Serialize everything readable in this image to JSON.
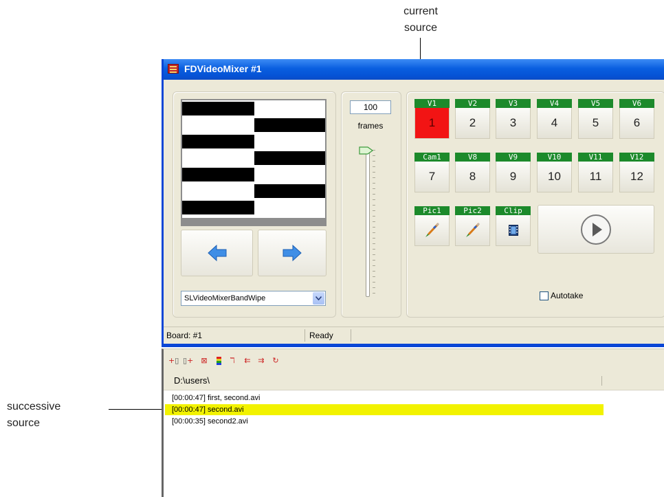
{
  "annotations": {
    "current_source": [
      "current",
      "source"
    ],
    "successive_source": [
      "successive",
      "source"
    ]
  },
  "window": {
    "title": "FDVideoMixer #1"
  },
  "transition": {
    "frames_value": "100",
    "frames_label": "frames",
    "selected": "SLVideoMixerBandWipe"
  },
  "sources": [
    {
      "label": "V1",
      "number": "1",
      "active": true
    },
    {
      "label": "V2",
      "number": "2"
    },
    {
      "label": "V3",
      "number": "3"
    },
    {
      "label": "V4",
      "number": "4"
    },
    {
      "label": "V5",
      "number": "5"
    },
    {
      "label": "V6",
      "number": "6"
    },
    {
      "label": "Cam1",
      "number": "7"
    },
    {
      "label": "V8",
      "number": "8"
    },
    {
      "label": "V9",
      "number": "9"
    },
    {
      "label": "V10",
      "number": "10"
    },
    {
      "label": "V11",
      "number": "11"
    },
    {
      "label": "V12",
      "number": "12"
    }
  ],
  "media_sources": [
    {
      "label": "Pic1",
      "icon": "brush-icon"
    },
    {
      "label": "Pic2",
      "icon": "brush-icon"
    },
    {
      "label": "Clip",
      "icon": "film-icon"
    }
  ],
  "autotake_label": "Autotake",
  "status": {
    "board": "Board: #1",
    "state": "Ready"
  },
  "playlist": {
    "path": "D:\\users\\",
    "entries": [
      "[00:00:47] first, second.avi",
      "[00:00:47] second.avi",
      "[00:00:35] second2.avi"
    ],
    "highlight_color": "#f2f200"
  },
  "colors": {
    "active_source": "#f21414",
    "source_label_bg": "#1c8a2b",
    "titlebar": "#0a5fe0"
  }
}
